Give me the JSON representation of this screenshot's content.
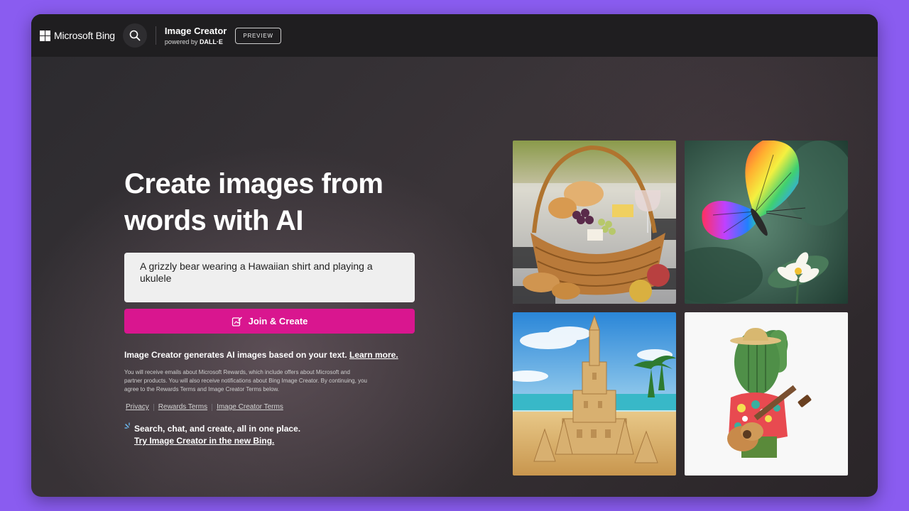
{
  "header": {
    "brand": "Microsoft Bing",
    "product_title": "Image Creator",
    "product_sub_prefix": "powered by ",
    "product_sub_brand": "DALL·E",
    "badge": "PREVIEW"
  },
  "main": {
    "headline": "Create images from words with AI",
    "prompt_value": "A grizzly bear wearing a Hawaiian shirt and playing a ukulele",
    "create_button": "Join & Create",
    "info_text": "Image Creator generates AI images based on your text. ",
    "info_link": "Learn more.",
    "legal_text": "You will receive emails about Microsoft Rewards, which include offers about Microsoft and partner products. You will also receive notifications about Bing Image Creator. By continuing, you agree to the Rewards Terms and Image Creator Terms below.",
    "links": [
      "Privacy",
      "Rewards Terms",
      "Image Creator Terms"
    ],
    "promo_text": "Search, chat, and create, all in one place.",
    "promo_link": "Try Image Creator in the new Bing."
  },
  "gallery": {
    "tiles": [
      "picnic-basket-image",
      "rainbow-butterfly-image",
      "sandcastle-image",
      "cactus-ukulele-image"
    ]
  },
  "colors": {
    "accent": "#d9168f",
    "page_bg": "#8a5cf0",
    "header_bg": "#1f1e20"
  }
}
